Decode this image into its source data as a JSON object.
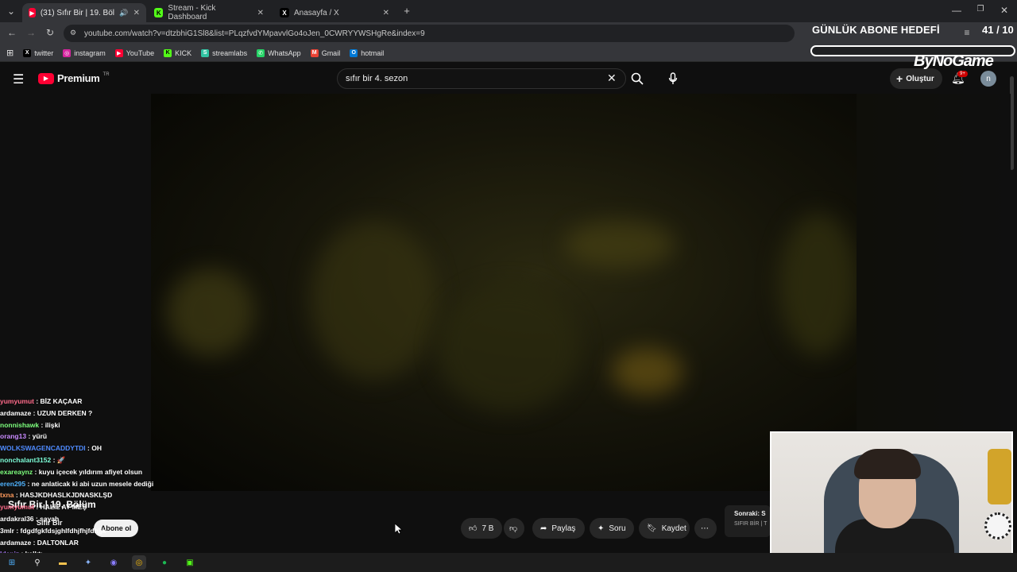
{
  "browser": {
    "tabs": [
      {
        "title": "(31) Sıfır Bir | 19. Bölüm - Yo",
        "favicon": "youtube-icon",
        "active": true
      },
      {
        "title": "Stream - Kick Dashboard",
        "favicon": "kick-icon",
        "active": false
      },
      {
        "title": "Anasayfa / X",
        "favicon": "x-icon",
        "active": false
      }
    ],
    "url": "youtube.com/watch?v=dtzbhiG1Sl8&list=PLqzfvdYMpavvlGo4oJen_0CWRYYWSHgRe&index=9",
    "bookmarks": [
      "twitter",
      "instagram",
      "YouTube",
      "KICK",
      "streamlabs",
      "WhatsApp",
      "Gmail",
      "hotmail"
    ]
  },
  "youtube": {
    "logo_text": "Premium",
    "logo_region": "TR",
    "search_value": "sıfır bir 4. sezon",
    "create_label": "Oluştur",
    "notif_badge": "9+",
    "avatar_letter": "n",
    "video_title": "Sıfır Bir | 19. Bölüm",
    "channel_name": "Sıfır Bir",
    "subscribe_label": "Abone ol",
    "like_count": "7 B",
    "share_label": "Paylaş",
    "ask_label": "Soru",
    "save_label": "Kaydet",
    "next_label": "Sonraki: S",
    "next_sub": "SIFIR BİR | T"
  },
  "overlay": {
    "subgoal_title": "GÜNLÜK ABONE HEDEFİ",
    "subgoal_count": "41 / 10",
    "brand": "ByNoGame"
  },
  "chat": [
    {
      "user": "yumyumut",
      "msg": "BİZ KAÇAAR",
      "color": "#ff6b8a"
    },
    {
      "user": "ardamaze",
      "msg": "UZUN DERKEN ?",
      "color": "#ffffff"
    },
    {
      "user": "nonnishawk",
      "msg": "ilişki",
      "color": "#7dff7d"
    },
    {
      "user": "orang13",
      "msg": "yürü",
      "color": "#c98bff"
    },
    {
      "user": "WOLKSWAGENCADDYTDI",
      "msg": "OH",
      "color": "#4f8bff"
    },
    {
      "user": "nonchalant3152",
      "msg": "🚀",
      "color": "#7dffd8"
    },
    {
      "user": "exareaynz",
      "msg": "kuyu içecek yıldırım afiyet olsun",
      "color": "#7dff7d"
    },
    {
      "user": "eren295",
      "msg": "ne anlaticak ki abi uzun mesele dediği",
      "color": "#4fb3ff"
    },
    {
      "user": "txna",
      "msg": "HASJKDHASLKJDNASKLŞD",
      "color": "#ff9a5c"
    },
    {
      "user": "yumyumut",
      "msg": "HALİL AY MEŞ",
      "color": "#ff6b8a"
    },
    {
      "user": "ardakral36",
      "msg": "sayah",
      "color": "#ffffff"
    },
    {
      "user": "3mlr",
      "msg": "fdgdfgkfdsjghlfdhjfhjfdhjjk",
      "color": "#ffffff"
    },
    {
      "user": "ardamaze",
      "msg": "DALTONLAR",
      "color": "#ffffff"
    },
    {
      "user": "ldeniz",
      "msg": "kalktı",
      "color": "#b07dff"
    }
  ]
}
